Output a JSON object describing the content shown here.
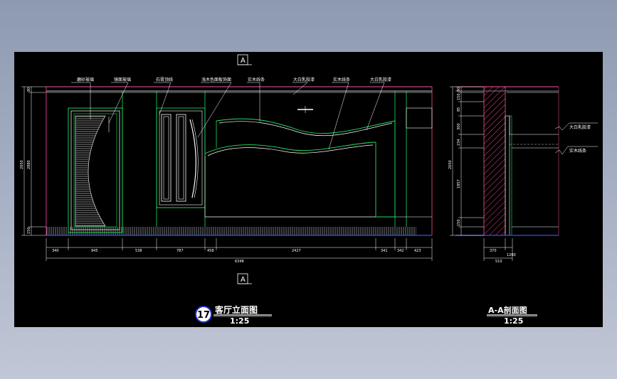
{
  "drawing": {
    "section_marker": "A",
    "elevation": {
      "number": "17",
      "title": "客厅立面图",
      "scale": "1:25",
      "leaders": [
        "磨砂玻璃",
        "镜面玻璃",
        "石膏顶线",
        "浅木色面板饰面",
        "实木线条",
        "大白乳胶漆",
        "实木线条",
        "大白乳胶漆"
      ],
      "dims_bottom": [
        "340",
        "945",
        "538",
        "787",
        "458",
        "2427",
        "341",
        "342",
        "423"
      ],
      "dim_total": "6348",
      "dims_left": [
        "2650",
        "2880",
        "150"
      ],
      "dim_small_top": "80"
    },
    "section": {
      "title": "A-A剖面图",
      "scale": "1:25",
      "labels": [
        "大白乳胶漆",
        "实木线条"
      ],
      "dims_left": [
        "80",
        "150",
        "85",
        "300",
        "234",
        "1857",
        "150",
        "2650"
      ],
      "dims_bottom": [
        "370",
        "1260",
        "510"
      ]
    }
  }
}
